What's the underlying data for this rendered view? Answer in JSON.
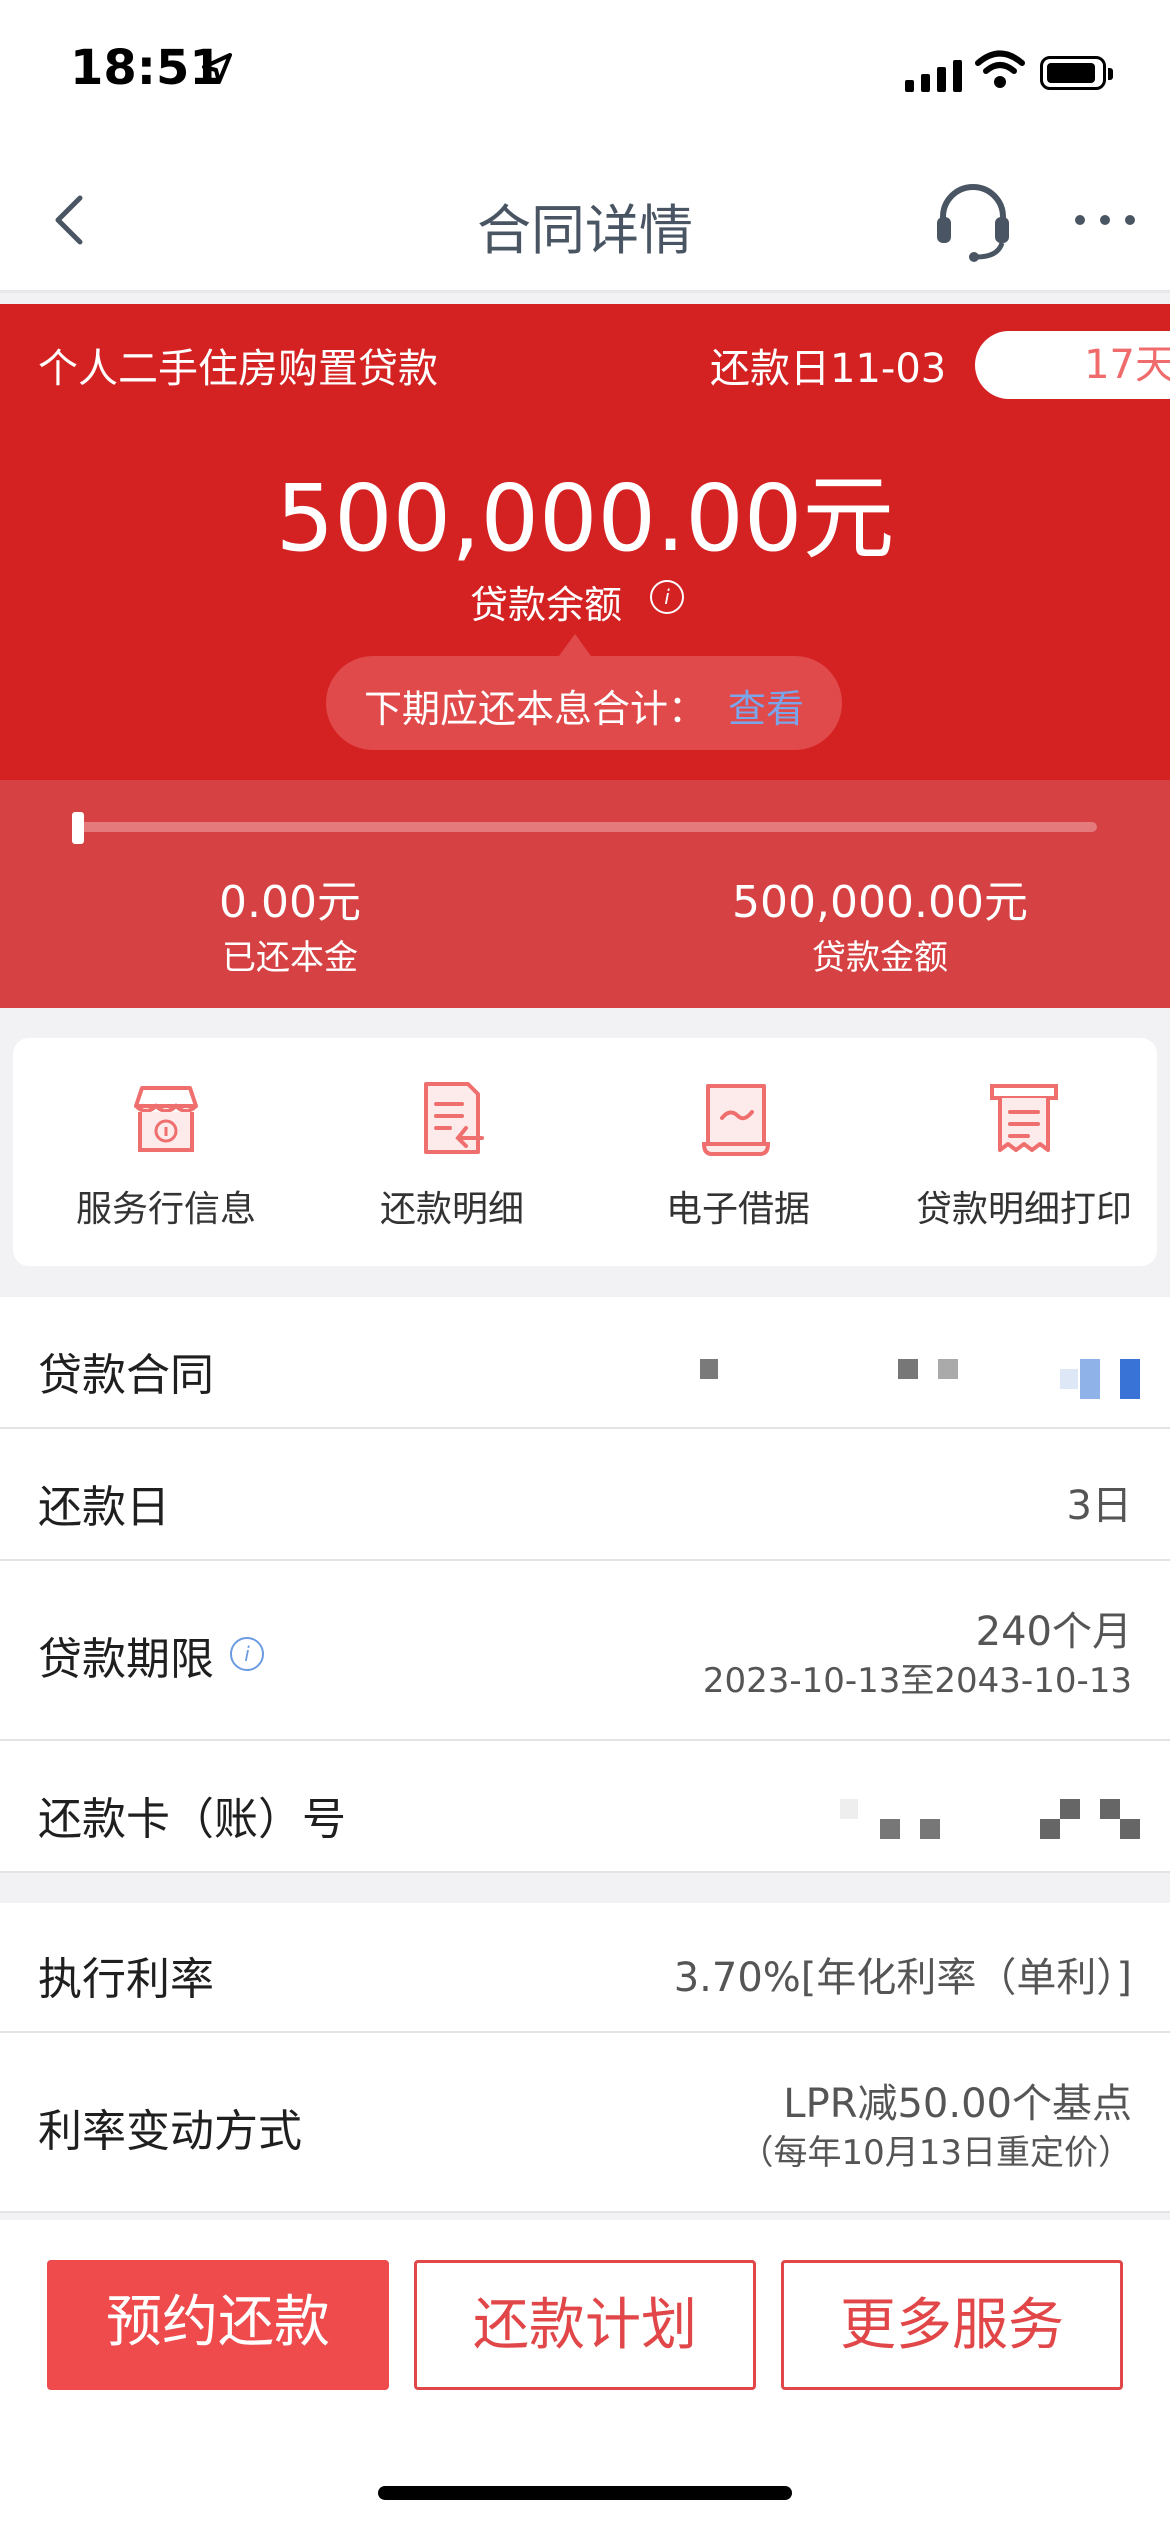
{
  "status_bar": {
    "time": "18:51"
  },
  "nav": {
    "title": "合同详情"
  },
  "banner": {
    "loan_type": "个人二手住房购置贷款",
    "repay_day": "还款日11-03",
    "days_left": "17天",
    "balance": "500,000.00元",
    "balance_label": "贷款余额",
    "next_payment_label": "下期应还本息合计：",
    "next_payment_link": "查看"
  },
  "progress": {
    "repaid_fraction": 0.0,
    "repaid_value": "0.00元",
    "repaid_label": "已还本金",
    "amount_value": "500,000.00元",
    "amount_label": "贷款金额"
  },
  "quick_actions": [
    {
      "label": "服务行信息",
      "icon": "bank-info-icon"
    },
    {
      "label": "还款明细",
      "icon": "repayment-detail-icon"
    },
    {
      "label": "电子借据",
      "icon": "e-receipt-icon"
    },
    {
      "label": "贷款明细打印",
      "icon": "print-icon"
    }
  ],
  "rows": {
    "contract": {
      "label": "贷款合同"
    },
    "repay_day": {
      "label": "还款日",
      "value": "3日"
    },
    "term": {
      "label": "贷款期限",
      "value": "240个月",
      "sub": "2023-10-13至2043-10-13"
    },
    "card": {
      "label": "还款卡（账）号"
    },
    "rate": {
      "label": "执行利率",
      "value": "3.70%[年化利率（单利）]"
    },
    "rate_change": {
      "label": "利率变动方式",
      "value": "LPR减50.00个基点",
      "sub": "（每年10月13日重定价）"
    }
  },
  "buttons": {
    "reserve": "预约还款",
    "plan": "还款计划",
    "more": "更多服务"
  },
  "colors": {
    "brand_red": "#d42223",
    "accent_red": "#ef4a4c",
    "link_blue": "#7aa5ea"
  }
}
